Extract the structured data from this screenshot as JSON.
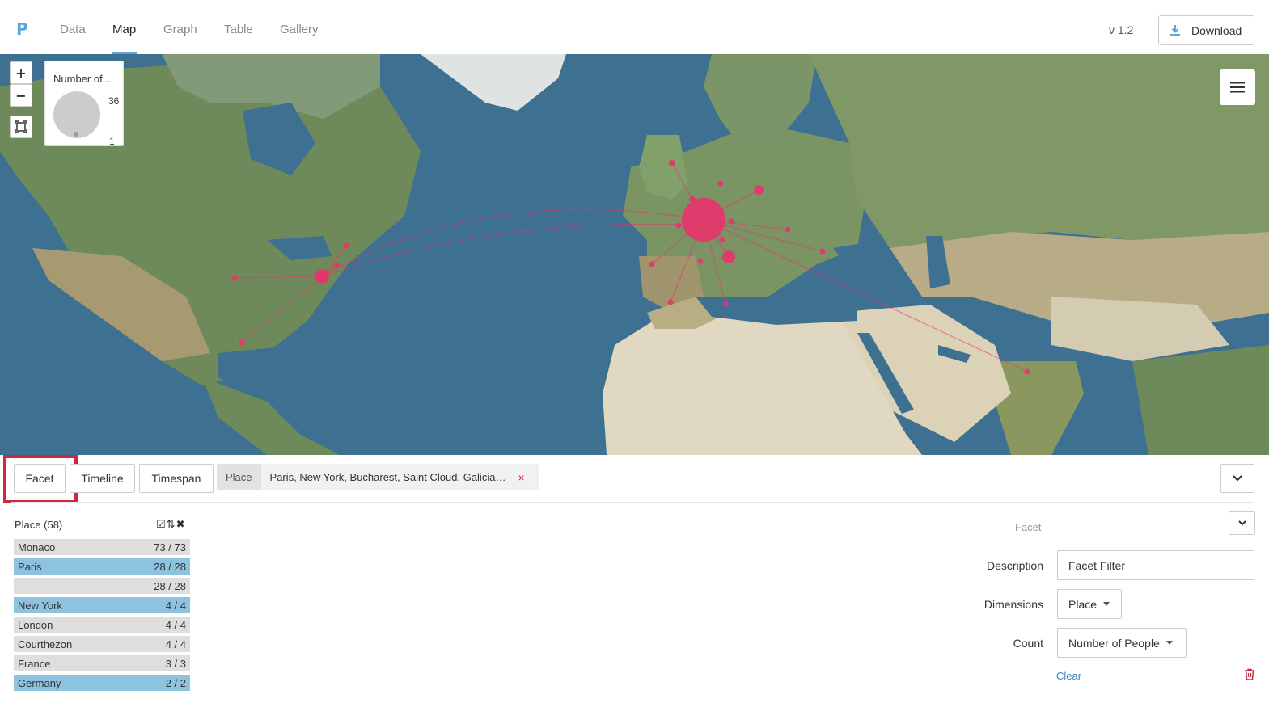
{
  "app": {
    "logo": "P",
    "version": "v 1.2",
    "download_label": "Download"
  },
  "nav": {
    "tabs": [
      "Data",
      "Map",
      "Graph",
      "Table",
      "Gallery"
    ],
    "active": "Map"
  },
  "map": {
    "zoom_in": "+",
    "zoom_out": "−",
    "legend": {
      "title": "Number of...",
      "max": "36",
      "min": "1"
    },
    "marker_color": "#e8336d"
  },
  "panel": {
    "buttons": {
      "facet": "Facet",
      "timeline": "Timeline",
      "timespan": "Timespan"
    },
    "filter_chip": {
      "label": "Place",
      "values": "Paris, New York, Bucharest, Saint Cloud, Galicia, S...",
      "remove": "×"
    },
    "facet_list": {
      "title": "Place (58)",
      "rows": [
        {
          "label": "Monaco",
          "count": "73 / 73",
          "selected": false
        },
        {
          "label": "Paris",
          "count": "28 / 28",
          "selected": true
        },
        {
          "label": "",
          "count": "28 / 28",
          "selected": false
        },
        {
          "label": "New York",
          "count": "4 / 4",
          "selected": true
        },
        {
          "label": "London",
          "count": "4 / 4",
          "selected": false
        },
        {
          "label": "Courthezon",
          "count": "4 / 4",
          "selected": false
        },
        {
          "label": "France",
          "count": "3 / 3",
          "selected": false
        },
        {
          "label": "Germany",
          "count": "2 / 2",
          "selected": true
        }
      ]
    },
    "settings": {
      "header": "Facet",
      "description_label": "Description",
      "description_value": "Facet Filter",
      "dimensions_label": "Dimensions",
      "dimensions_value": "Place",
      "count_label": "Count",
      "count_value": "Number of People",
      "clear_label": "Clear"
    }
  },
  "colors": {
    "accent": "#5aa6d9",
    "selected_row": "#8ec3e0",
    "unselected_row": "#dedede",
    "danger": "#d0293f"
  }
}
